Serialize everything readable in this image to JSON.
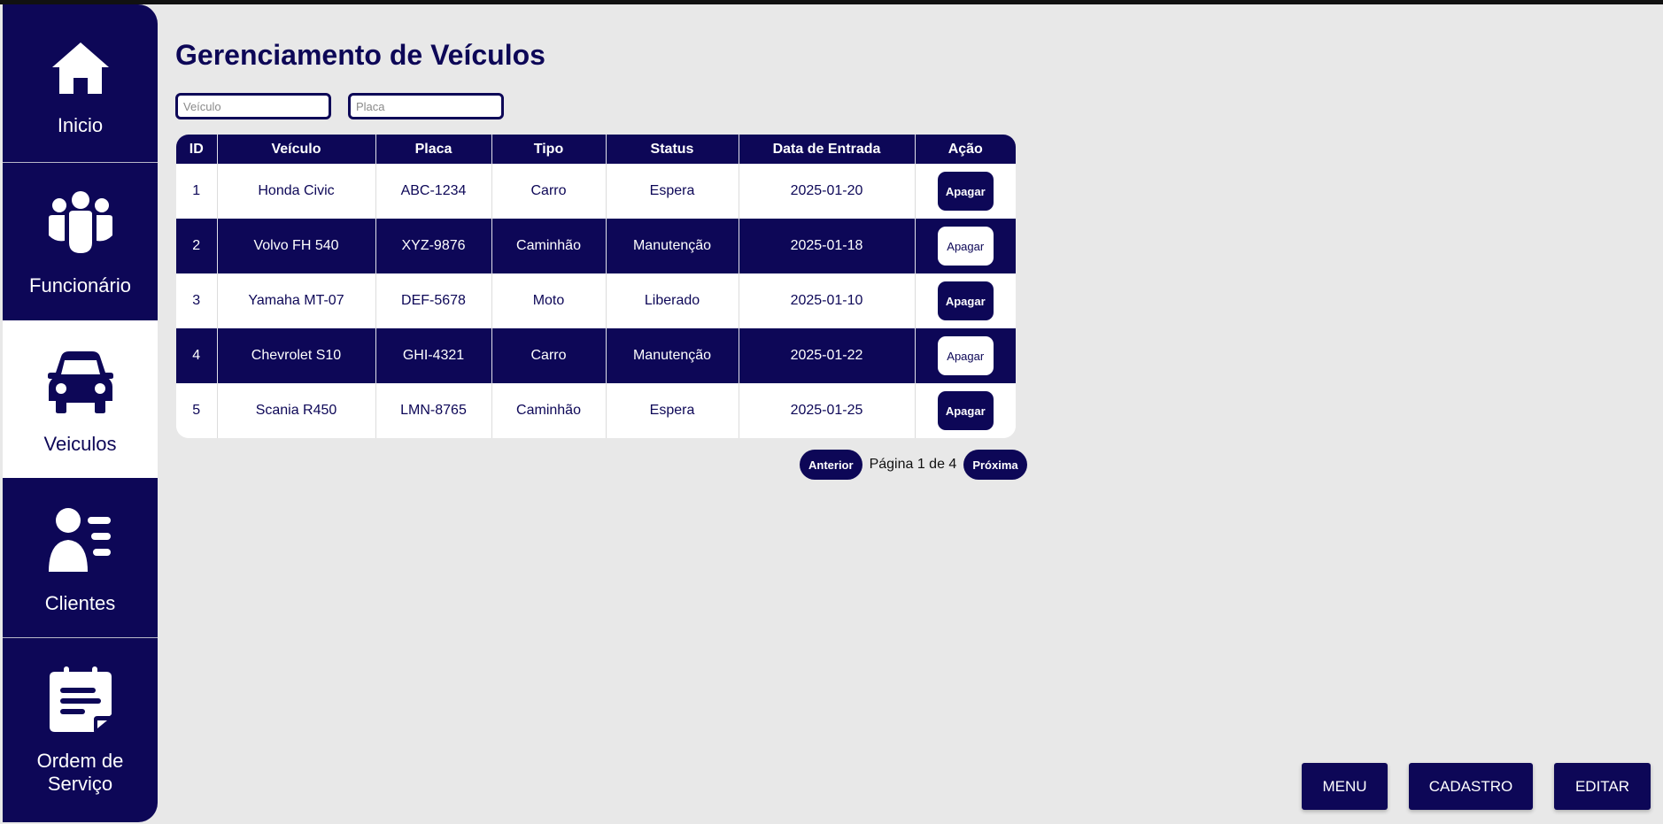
{
  "page": {
    "title": "Gerenciamento de Veículos"
  },
  "colors": {
    "primary": "#0d0757",
    "background": "#e8e8e8",
    "surface": "#ffffff"
  },
  "sidebar": {
    "items": [
      {
        "label": "Inicio",
        "icon": "home-icon",
        "active": false
      },
      {
        "label": "Funcionário",
        "icon": "group-icon",
        "active": false
      },
      {
        "label": "Veiculos",
        "icon": "car-icon",
        "active": true
      },
      {
        "label": "Clientes",
        "icon": "client-list-icon",
        "active": false
      },
      {
        "label": "Ordem de Serviço",
        "icon": "service-order-icon",
        "active": false
      }
    ]
  },
  "filters": {
    "vehicle_placeholder": "Veículo",
    "plate_placeholder": "Placa"
  },
  "table": {
    "columns": [
      "ID",
      "Veículo",
      "Placa",
      "Tipo",
      "Status",
      "Data de Entrada",
      "Ação"
    ],
    "rows": [
      {
        "id": "1",
        "vehicle": "Honda Civic",
        "plate": "ABC-1234",
        "type": "Carro",
        "status": "Espera",
        "date": "2025-01-20",
        "action": "Apagar"
      },
      {
        "id": "2",
        "vehicle": "Volvo FH 540",
        "plate": "XYZ-9876",
        "type": "Caminhão",
        "status": "Manutenção",
        "date": "2025-01-18",
        "action": "Apagar"
      },
      {
        "id": "3",
        "vehicle": "Yamaha MT-07",
        "plate": "DEF-5678",
        "type": "Moto",
        "status": "Liberado",
        "date": "2025-01-10",
        "action": "Apagar"
      },
      {
        "id": "4",
        "vehicle": "Chevrolet S10",
        "plate": "GHI-4321",
        "type": "Carro",
        "status": "Manutenção",
        "date": "2025-01-22",
        "action": "Apagar"
      },
      {
        "id": "5",
        "vehicle": "Scania R450",
        "plate": "LMN-8765",
        "type": "Caminhão",
        "status": "Espera",
        "date": "2025-01-25",
        "action": "Apagar"
      }
    ]
  },
  "pagination": {
    "prev_label": "Anterior",
    "page_text": "Página 1 de 4",
    "next_label": "Próxima"
  },
  "actions": {
    "menu_label": "MENU",
    "register_label": "CADASTRO",
    "edit_label": "EDITAR"
  }
}
